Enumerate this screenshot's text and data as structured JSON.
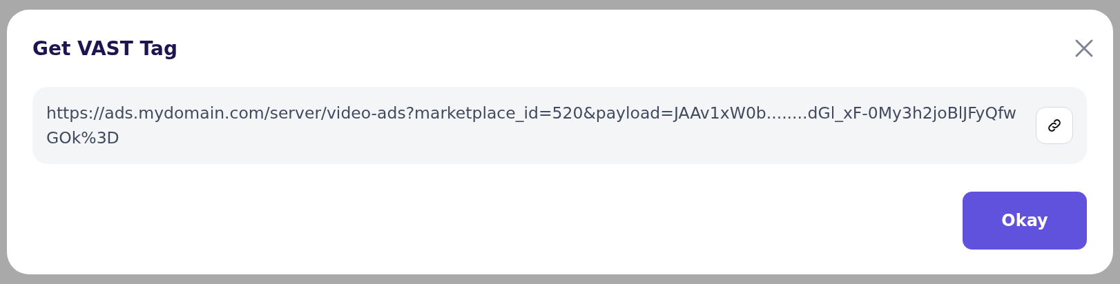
{
  "dialog": {
    "title": "Get VAST Tag",
    "tag_field": {
      "value": "https://ads.mydomain.com/server/video-ads?marketplace_id=520&payload=JAAv1xW0b........dGl_xF-0My3h2joBlJFyQfwGOk%3D"
    },
    "buttons": [
      "Okay"
    ]
  }
}
